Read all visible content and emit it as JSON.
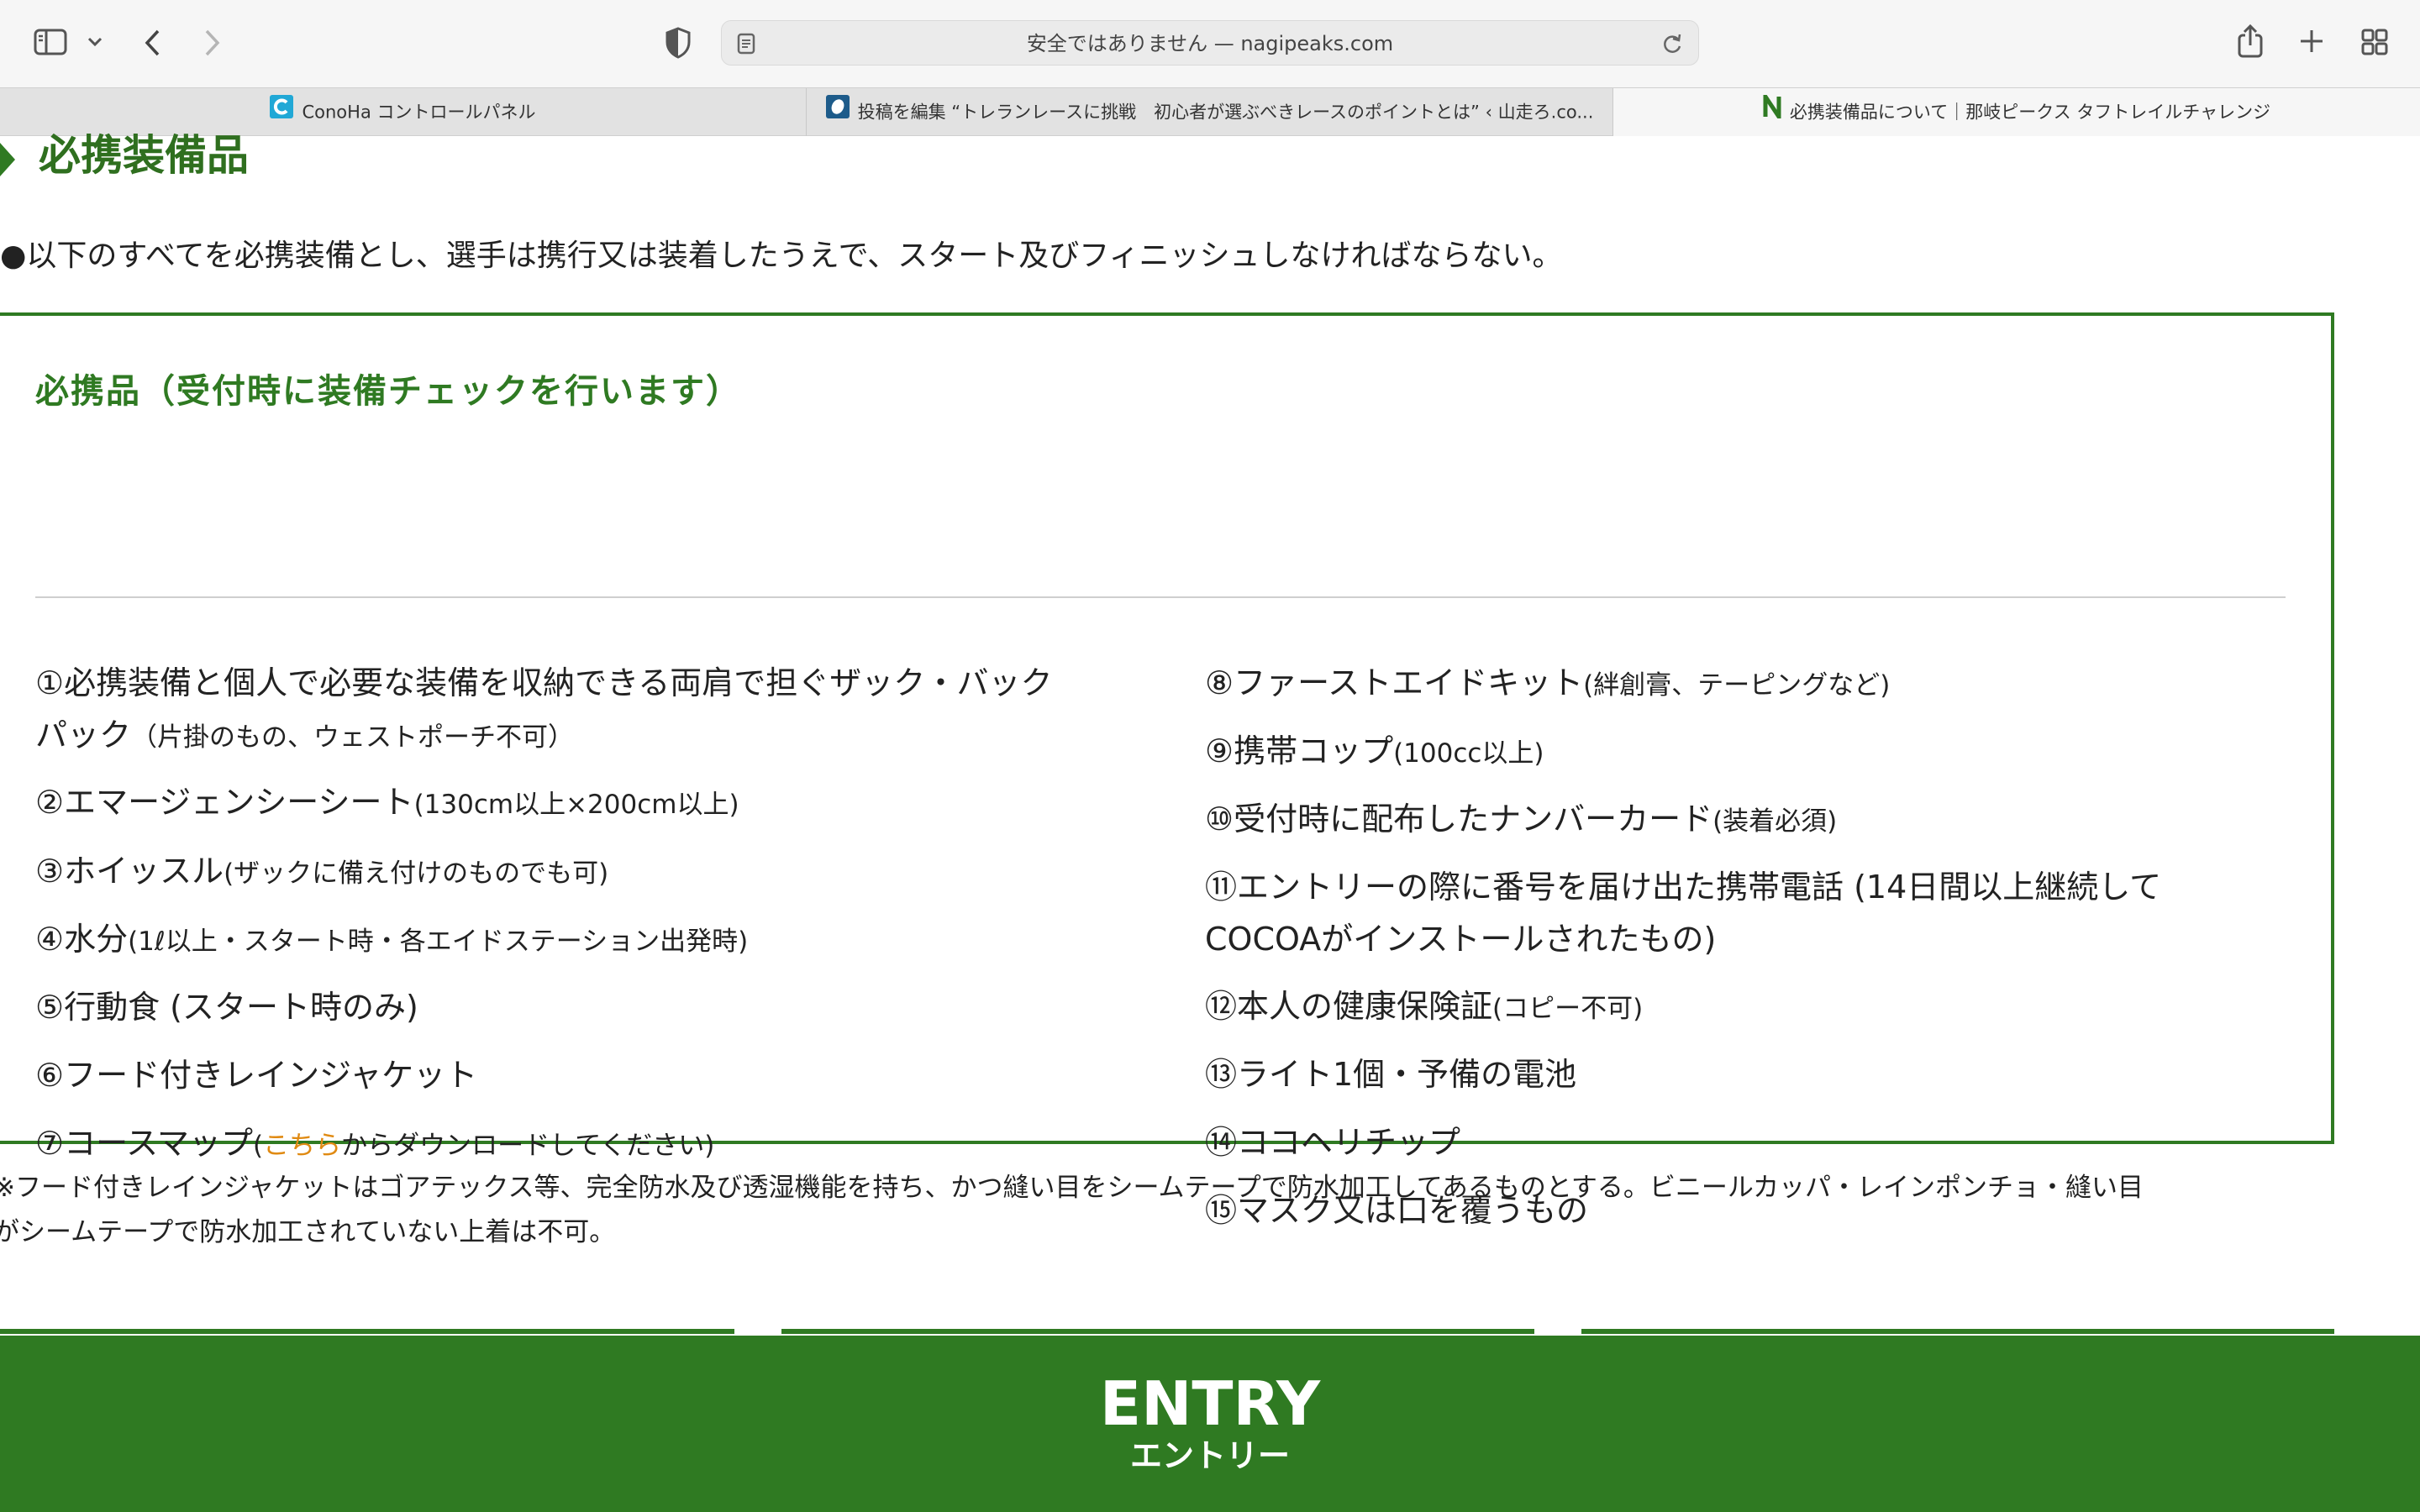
{
  "browser": {
    "address": "安全ではありません — nagipeaks.com",
    "tabs": [
      {
        "label": "ConoHa コントロールパネル",
        "active": false
      },
      {
        "label": "投稿を編集 “トレランレースに挑戦　初心者が選ぶべきレースのポイントとは” ‹ 山走ろ.co...",
        "active": false
      },
      {
        "label": "必携装備品について｜那岐ピークス タフトレイルチャレンジ",
        "active": true
      }
    ],
    "icons": [
      "sidebar-icon",
      "chevron-down-icon",
      "back-icon",
      "forward-icon",
      "shield-icon",
      "page-icon",
      "reload-icon",
      "share-icon",
      "plus-icon",
      "tab-overview-icon"
    ]
  },
  "page": {
    "section_title": "必携装備品",
    "intro": "●以下のすべてを必携装備とし、選手は携行又は装着したうえで、スタート及びフィニッシュしなければならない。",
    "box_title": "必携品（受付時に装備チェックを行います）",
    "left_items": [
      {
        "main": "①必携装備と個人で必要な装備を収納できる両肩で担ぐザック・バック",
        "main2": "パック",
        "note": "（片掛のもの、ウェストポーチ不可）"
      },
      {
        "main": "②エマージェンシーシート",
        "note": "(130cm以上×200cm以上)"
      },
      {
        "main": "③ホイッスル",
        "note": "(ザックに備え付けのものでも可)"
      },
      {
        "main": "④水分",
        "note": "(1ℓ以上・スタート時・各エイドステーション出発時)"
      },
      {
        "main": "⑤行動食 (スタート時のみ)",
        "note": ""
      },
      {
        "main": "⑥フード付きレインジャケット",
        "note": ""
      },
      {
        "main": "⑦コースマップ",
        "note_pre": "(",
        "link": "こちら",
        "note_post": "からダウンロードしてください)"
      }
    ],
    "right_items": [
      {
        "main": "⑧ファーストエイドキット",
        "note": "(絆創膏、テーピングなど)"
      },
      {
        "main": "⑨携帯コップ",
        "note": "(100cc以上)"
      },
      {
        "main": "⑩受付時に配布したナンバーカード",
        "note": "(装着必須)"
      },
      {
        "main": "⑪エントリーの際に番号を届け出た携帯電話 (14日間以上継続して",
        "main2": "COCOAがインストールされたもの)",
        "note": ""
      },
      {
        "main": "⑫本人の健康保険証",
        "note": "(コピー不可)"
      },
      {
        "main": "⑬ライト1個・予備の電池",
        "note": ""
      },
      {
        "main": "⑭ココヘリチップ",
        "note": ""
      },
      {
        "main": "⑮マスク又は口を覆うもの",
        "note": ""
      }
    ],
    "footnote_line1": "※フード付きレインジャケットはゴアテックス等、完全防水及び透湿機能を持ち、かつ縫い目をシームテープで防水加工してあるものとする。ビニールカッパ・レインポンチョ・縫い目",
    "footnote_line2": "がシームテープで防水加工されていない上着は不可。",
    "entry_title": "ENTRY",
    "entry_sub": "エントリー",
    "colors": {
      "brand_green": "#2f7a22",
      "link_orange": "#e08a12"
    }
  }
}
